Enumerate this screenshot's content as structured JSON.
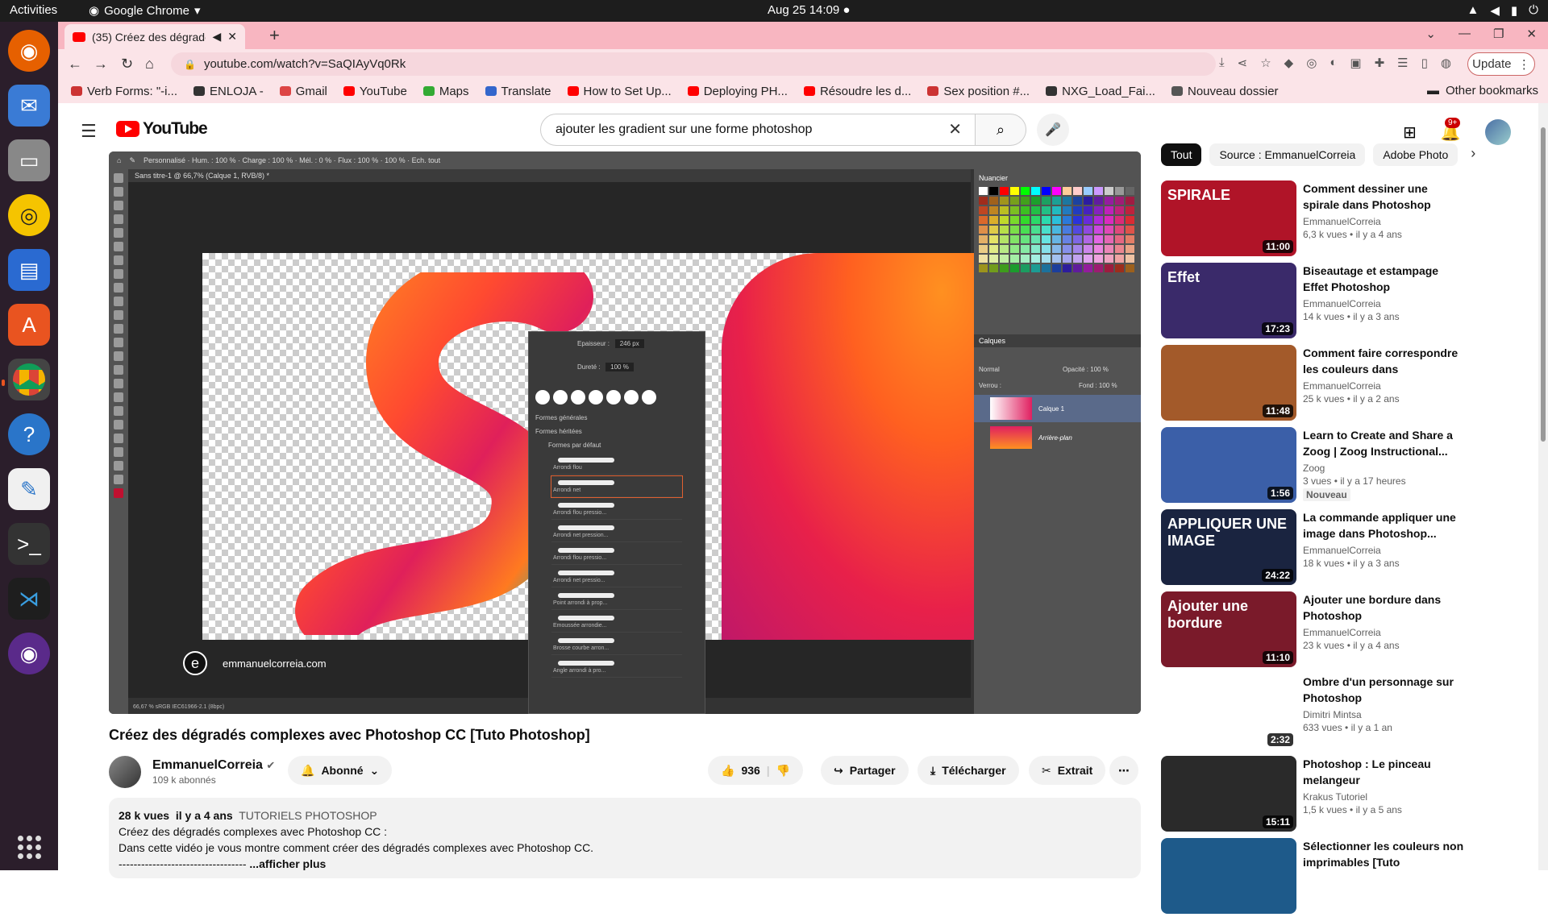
{
  "system": {
    "activities": "Activities",
    "app_name": "Google Chrome",
    "clock": "Aug 25  14:09"
  },
  "browser": {
    "tab_title": "(35) Créez des dégradé",
    "url": "youtube.com/watch?v=SaQIAyVq0Rk",
    "update_label": "Update",
    "bookmarks": [
      {
        "label": "Verb Forms: \"-i...",
        "color": "#c33"
      },
      {
        "label": "ENLOJA -",
        "color": "#333"
      },
      {
        "label": "Gmail",
        "color": "#d44"
      },
      {
        "label": "YouTube",
        "color": "#f00"
      },
      {
        "label": "Maps",
        "color": "#3a3"
      },
      {
        "label": "Translate",
        "color": "#36c"
      },
      {
        "label": "How to Set Up...",
        "color": "#f00"
      },
      {
        "label": "Deploying PH...",
        "color": "#f00"
      },
      {
        "label": "Résoudre les d...",
        "color": "#f00"
      },
      {
        "label": "Sex position #...",
        "color": "#c33"
      },
      {
        "label": "NXG_Load_Fai...",
        "color": "#333"
      },
      {
        "label": "Nouveau dossier",
        "color": "#555"
      }
    ],
    "other_bookmarks": "Other bookmarks"
  },
  "youtube": {
    "logo": "YouTube",
    "search_value": "ajouter les gradient sur une forme photoshop",
    "notif_count": "9+",
    "video": {
      "title": "Créez des dégradés complexes avec Photoshop CC [Tuto Photoshop]",
      "channel": "EmmanuelCorreia",
      "subscribers": "109 k abonnés",
      "subscribe_label": "Abonné",
      "likes": "936",
      "share": "Partager",
      "download": "Télécharger",
      "clip": "Extrait",
      "views": "28 k vues",
      "age": "il y a 4 ans",
      "tag": "TUTORIELS PHOTOSHOP",
      "desc_line1": "Créez des dégradés complexes avec Photoshop CC :",
      "desc_line2": "Dans cette vidéo je vous montre comment créer des dégradés complexes avec Photoshop CC.",
      "desc_line3": "----------------------------------",
      "show_more": "...afficher plus"
    },
    "player": {
      "ps_tab": "Sans titre-1 @ 66,7% (Calque 1, RVB/8) *",
      "watermark": "emmanuelcorreia.com",
      "epaisseur_label": "Epaisseur :",
      "epaisseur_value": "246 px",
      "durete_label": "Dureté :",
      "durete_value": "100 %",
      "formes_generales": "Formes générales",
      "formes_heritees": "Formes héritées",
      "formes_defaut": "Formes par défaut",
      "brushes": [
        "Arrondi flou",
        "Arrondi net",
        "Arrondi flou pressio...",
        "Arrondi net pression...",
        "Arrondi flou pressio...",
        "Arrondi net pressio...",
        "Point arrondi à prop...",
        "Emoussée arrondie...",
        "Brosse courbe arron...",
        "Angle arrondi à pro..."
      ],
      "nuancier": "Nuancier",
      "calques": "Calques",
      "layer1": "Calque 1",
      "layer2": "Arrière-plan",
      "ps_mode": "Normal",
      "opacite": "Opacité : 100 %",
      "fond": "Fond : 100 %",
      "verrou": "Verrou :",
      "ps_status": "66,67 %  sRGB IEC61966-2.1 (8bpc)"
    },
    "chips": [
      "Tout",
      "Source : EmmanuelCorreia",
      "Adobe Photo"
    ],
    "recommendations": [
      {
        "title": "Comment dessiner une spirale dans Photoshop",
        "channel": "EmmanuelCorreia",
        "meta": "6,3 k vues  •  il y a 4 ans",
        "duration": "11:00",
        "thumb_text": "SPIRALE",
        "bg": "#b01428"
      },
      {
        "title": "Biseautage et estampage Effet Photoshop",
        "channel": "EmmanuelCorreia",
        "meta": "14 k vues  •  il y a 3 ans",
        "duration": "17:23",
        "thumb_text": "Effet",
        "bg": "#3a2a6a"
      },
      {
        "title": "Comment faire correspondre les couleurs dans Photoshop...",
        "channel": "EmmanuelCorreia",
        "meta": "25 k vues  •  il y a 2 ans",
        "duration": "11:48",
        "thumb_text": "",
        "bg": "#a35a2a"
      },
      {
        "title": "Learn to Create and Share a Zoog | Zoog Instructional...",
        "channel": "Zoog",
        "meta": "3 vues  •  il y a 17 heures",
        "duration": "1:56",
        "thumb_text": "",
        "bg": "#3b5fa8",
        "badge": "Nouveau"
      },
      {
        "title": "La commande appliquer une image dans Photoshop...",
        "channel": "EmmanuelCorreia",
        "meta": "18 k vues  •  il y a 3 ans",
        "duration": "24:22",
        "thumb_text": "APPLIQUER UNE IMAGE",
        "bg": "#1a2440"
      },
      {
        "title": "Ajouter une bordure dans Photoshop",
        "channel": "EmmanuelCorreia",
        "meta": "23 k vues  •  il y a 4 ans",
        "duration": "11:10",
        "thumb_text": "Ajouter une bordure",
        "bg": "#7a1a2a"
      },
      {
        "title": "Ombre d'un personnage sur Photoshop",
        "channel": "Dimitri Mintsa",
        "meta": "633 vues  •  il y a 1 an",
        "duration": "2:32",
        "thumb_text": "",
        "bg": "#ffffff"
      },
      {
        "title": "Photoshop : Le pinceau melangeur",
        "channel": "Krakus Tutoriel",
        "meta": "1,5 k vues  •  il y a 5 ans",
        "duration": "15:11",
        "thumb_text": "",
        "bg": "#2a2a2a"
      },
      {
        "title": "Sélectionner les couleurs non imprimables [Tuto Photoshop]",
        "channel": "",
        "meta": "",
        "duration": "",
        "thumb_text": "",
        "bg": "#1e5a8a"
      }
    ]
  }
}
